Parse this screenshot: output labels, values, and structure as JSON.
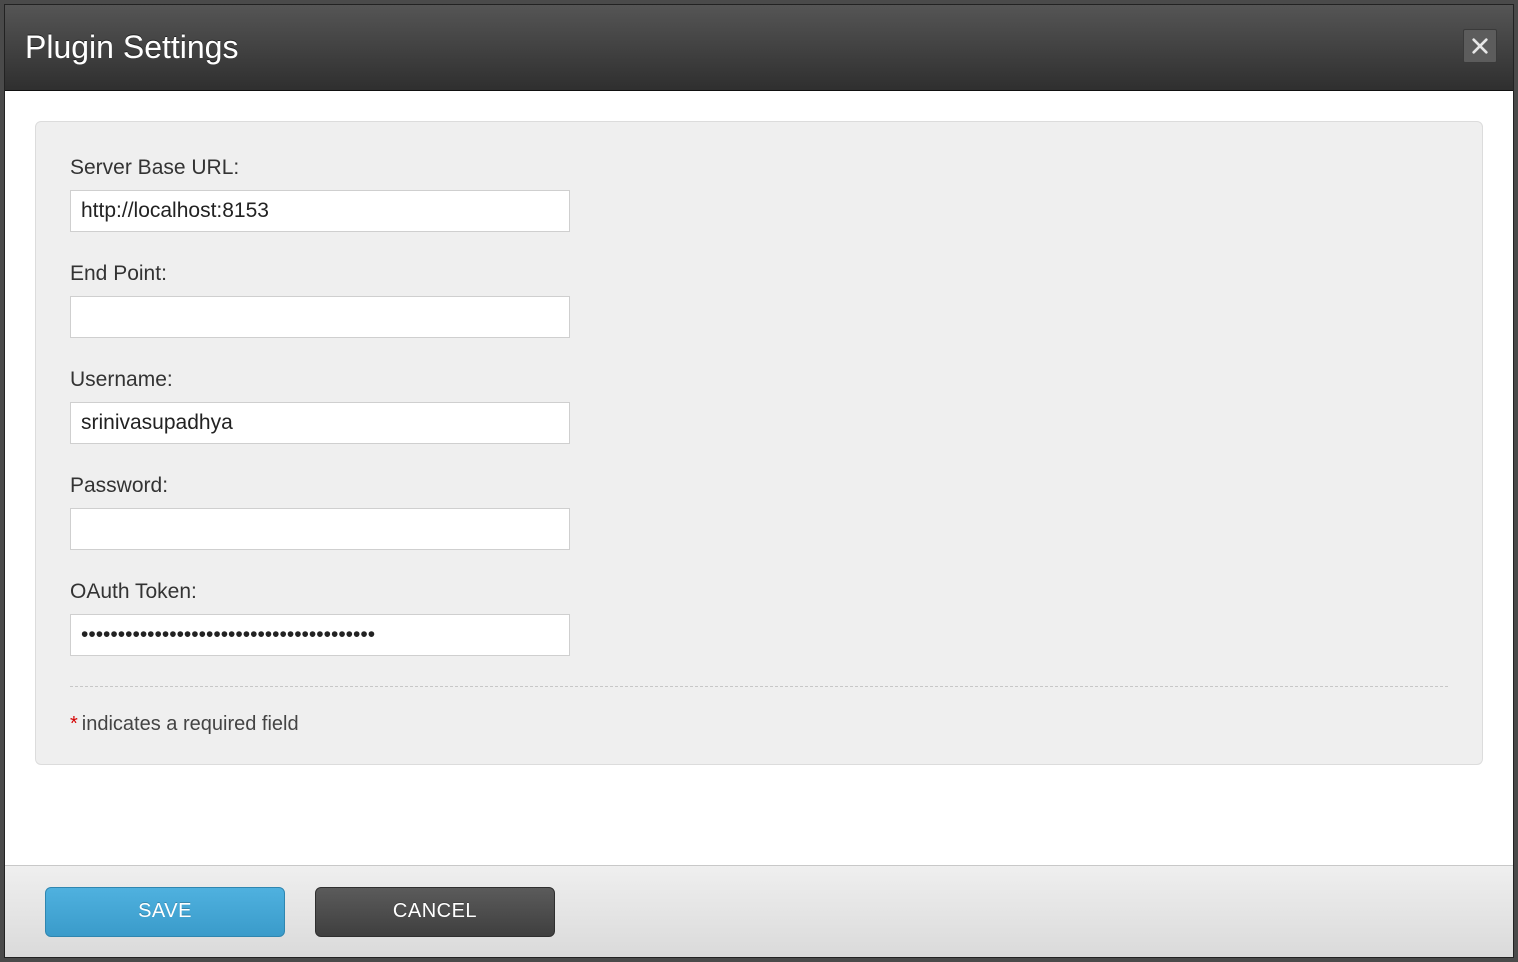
{
  "modal": {
    "title": "Plugin Settings"
  },
  "form": {
    "fields": {
      "server_base_url": {
        "label": "Server Base URL:",
        "value": "http://localhost:8153"
      },
      "end_point": {
        "label": "End Point:",
        "value": ""
      },
      "username": {
        "label": "Username:",
        "value": "srinivasupadhya"
      },
      "password": {
        "label": "Password:",
        "value": ""
      },
      "oauth_token": {
        "label": "OAuth Token:",
        "value": "••••••••••••••••••••••••••••••••••••••••"
      }
    },
    "required_note": "indicates a required field",
    "required_marker": "*"
  },
  "footer": {
    "save_label": "SAVE",
    "cancel_label": "CANCEL"
  }
}
